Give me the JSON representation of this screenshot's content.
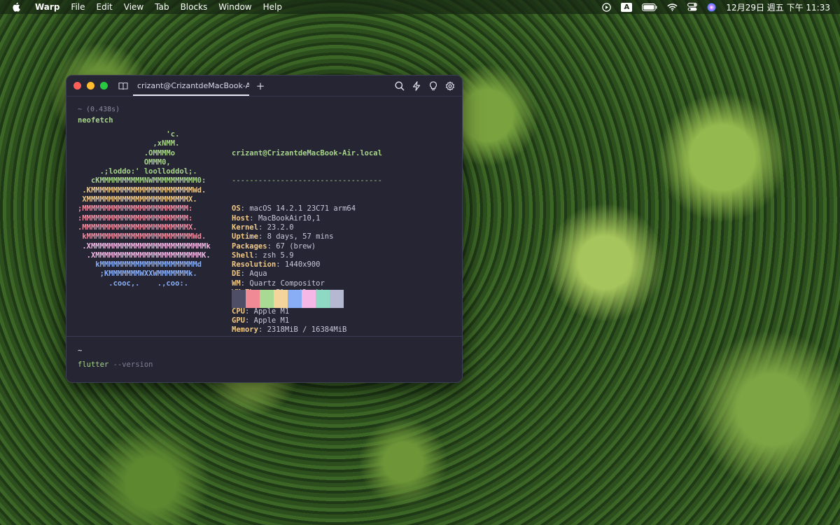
{
  "menubar": {
    "app_name": "Warp",
    "items": [
      "File",
      "Edit",
      "View",
      "Tab",
      "Blocks",
      "Window",
      "Help"
    ],
    "input_source": "A",
    "clock": "12月29日 週五 下午 11:33",
    "icons": [
      "apple-logo-icon",
      "play-circle-icon",
      "input-source-icon",
      "battery-icon",
      "wifi-icon",
      "control-center-icon",
      "siri-icon"
    ]
  },
  "window": {
    "tab_title": "crizant@CrizantdeMacBook-Air",
    "new_tab_label": "+",
    "tools": [
      "search-icon",
      "bolt-icon",
      "lightbulb-icon",
      "settings-icon"
    ]
  },
  "block1": {
    "meta": "~ (0.438s)",
    "command": "neofetch"
  },
  "logo_lines": [
    {
      "text": "                    'c.",
      "color": "#a8d48a"
    },
    {
      "text": "                 ,xNMM.",
      "color": "#a8d48a"
    },
    {
      "text": "               .OMMMMo",
      "color": "#a8d48a"
    },
    {
      "text": "               OMMM0,",
      "color": "#a8d48a"
    },
    {
      "text": "     .;loddo:' loolloddol;.",
      "color": "#a8d48a"
    },
    {
      "text": "   cKMMMMMMMMMMNWMMMMMMMMMM0:",
      "color": "#a8d48a"
    },
    {
      "text": " .KMMMMMMMMMMMMMMMMMMMMMMMWd.",
      "color": "#f0c987"
    },
    {
      "text": " XMMMMMMMMMMMMMMMMMMMMMMMX.",
      "color": "#f0c987"
    },
    {
      "text": ";MMMMMMMMMMMMMMMMMMMMMMMM:",
      "color": "#f08ca0"
    },
    {
      "text": ":MMMMMMMMMMMMMMMMMMMMMMMM:",
      "color": "#f08ca0"
    },
    {
      "text": ".MMMMMMMMMMMMMMMMMMMMMMMMX.",
      "color": "#f08ca0"
    },
    {
      "text": " kMMMMMMMMMMMMMMMMMMMMMMMMWd.",
      "color": "#f08ca0"
    },
    {
      "text": " .XMMMMMMMMMMMMMMMMMMMMMMMMMMk",
      "color": "#f5b8e6"
    },
    {
      "text": "  .XMMMMMMMMMMMMMMMMMMMMMMMMK.",
      "color": "#f5b8e6"
    },
    {
      "text": "    kMMMMMMMMMMMMMMMMMMMMMMd",
      "color": "#8aaef5"
    },
    {
      "text": "     ;KMMMMMMMWXXWMMMMMMMk.",
      "color": "#8aaef5"
    },
    {
      "text": "       .cooc,.    .,coo:.",
      "color": "#8aaef5"
    }
  ],
  "sysinfo": {
    "title": "crizant@CrizantdeMacBook-Air.local",
    "separator": "----------------------------------",
    "rows": [
      {
        "key": "OS",
        "value": "macOS 14.2.1 23C71 arm64"
      },
      {
        "key": "Host",
        "value": "MacBookAir10,1"
      },
      {
        "key": "Kernel",
        "value": "23.2.0"
      },
      {
        "key": "Uptime",
        "value": "8 days, 57 mins"
      },
      {
        "key": "Packages",
        "value": "67 (brew)"
      },
      {
        "key": "Shell",
        "value": "zsh 5.9"
      },
      {
        "key": "Resolution",
        "value": "1440x900"
      },
      {
        "key": "DE",
        "value": "Aqua"
      },
      {
        "key": "WM",
        "value": "Quartz Compositor"
      },
      {
        "key": "WM Theme",
        "value": "Blue (Dark)"
      },
      {
        "key": "Terminal",
        "value": "WarpTerminal"
      },
      {
        "key": "CPU",
        "value": "Apple M1"
      },
      {
        "key": "GPU",
        "value": "Apple M1"
      },
      {
        "key": "Memory",
        "value": "2318MiB / 16384MiB"
      }
    ],
    "swatch_colors": [
      "#4e4f66",
      "#f08a94",
      "#a8da94",
      "#f3d49a",
      "#8aaef5",
      "#f5b8e6",
      "#8fd8c4",
      "#b4b8d0"
    ]
  },
  "block2": {
    "dir": "~",
    "command": "flutter",
    "args": "--version"
  }
}
